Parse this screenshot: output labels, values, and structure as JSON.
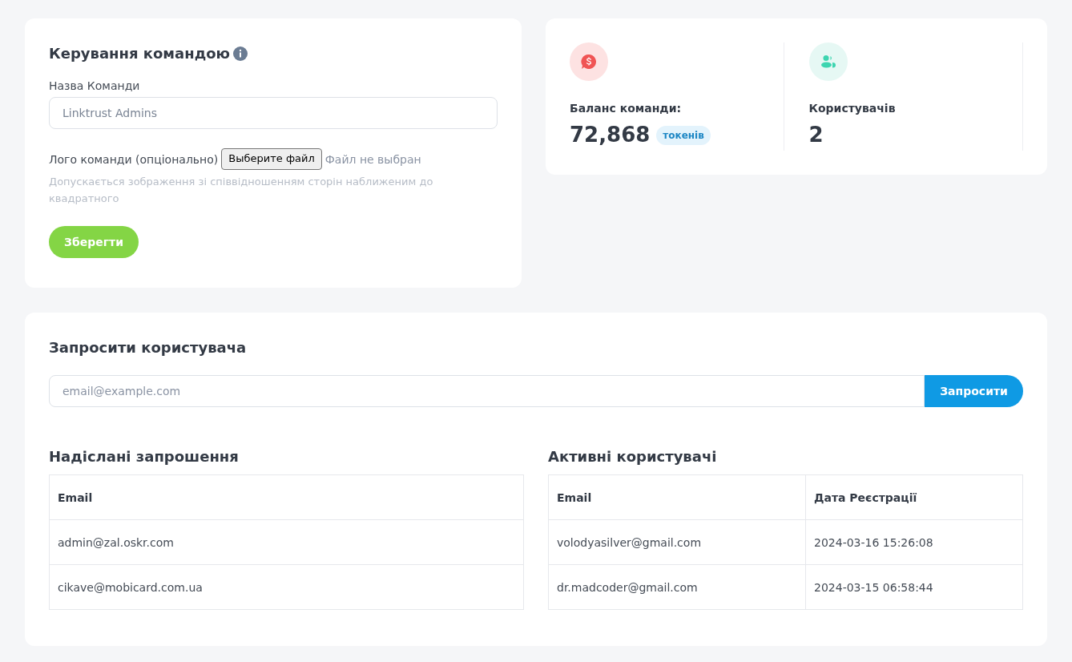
{
  "team": {
    "title": "Керування командою",
    "name_label": "Назва Команди",
    "name_value": "Linktrust Admins",
    "logo_label": "Лого команди (опціонально)",
    "file_button": "Выберите файл",
    "file_status": "Файл не выбран",
    "logo_hint": "Допускається зображення зі співвідношенням сторін наближеним до квадратного",
    "save": "Зберегти"
  },
  "stats": [
    {
      "kind": "balance",
      "label": "Баланс команди:",
      "value": "72,868",
      "badge": "токенів"
    },
    {
      "kind": "users",
      "label": "Користувачів",
      "value": "2"
    }
  ],
  "invite": {
    "title": "Запросити користувача",
    "placeholder": "email@example.com",
    "button": "Запросити"
  },
  "sent": {
    "title": "Надіслані запрошення",
    "columns": [
      "Email"
    ],
    "rows": [
      [
        "admin@zal.oskr.com"
      ],
      [
        "cikave@mobicard.com.ua"
      ]
    ]
  },
  "active": {
    "title": "Активні користувачі",
    "columns": [
      "Email",
      "Дата Реєстрації"
    ],
    "rows": [
      [
        "volodyasilver@gmail.com",
        "2024-03-16 15:26:08"
      ],
      [
        "dr.madcoder@gmail.com",
        "2024-03-15 06:58:44"
      ]
    ]
  }
}
